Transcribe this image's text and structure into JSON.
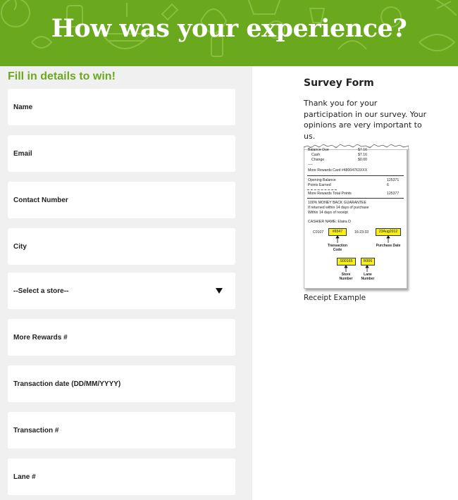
{
  "banner": {
    "title": "How was your experience?",
    "color": "#6aa81e"
  },
  "form": {
    "heading": "Fill in details to win!",
    "heading_color": "#6aa81e",
    "fields": {
      "name": "Name",
      "email": "Email",
      "contact_number": "Contact Number",
      "city": "City",
      "store_select": "--Select a store--",
      "more_rewards": "More Rewards #",
      "transaction_date": "Transaction date (DD/MM/YYYY)",
      "transaction_number": "Transaction #",
      "lane_number": "Lane #"
    }
  },
  "survey": {
    "title": "Survey Form",
    "text": "Thank you for your participation in our survey. Your opinions are very important to us.",
    "receipt_caption": "Receipt Example"
  },
  "receipt": {
    "header_partial": "Balance Due",
    "header_amount": "$7.16",
    "cash_label": "Cash",
    "cash_amount": "$7.16",
    "change_label": "Change",
    "change_amount": "$0.00",
    "dashes": "----",
    "more_rewards_card": "More Rewards Card  #48004763XXX",
    "opening_balance_label": "Opening Balance",
    "opening_balance_value": "125371",
    "points_earned_label": "Points Earned",
    "points_earned_value": "6",
    "total_points_label": "More Rewards Total Points",
    "total_points_value": "125377",
    "guarantee_1": "100% MONEY BACK GUARANTEE",
    "guarantee_2": "If returned within 14 days of purchase",
    "guarantee_3": "Within 14 days of receipt",
    "cashier": "CASHIER NAME:  Elaira D",
    "code_prefix": "C0107",
    "transaction_code": "#6547",
    "time": "16:23:33",
    "purchase_date": "23Aug2012",
    "transaction_code_label_1": "Transaction",
    "transaction_code_label_2": "Code",
    "purchase_date_label": "Purchase Date",
    "store_number": "S00165",
    "lane_number": "R006",
    "store_label_1": "Store",
    "store_label_2": "Number",
    "lane_label_1": "Lane",
    "lane_label_2": "Number"
  }
}
